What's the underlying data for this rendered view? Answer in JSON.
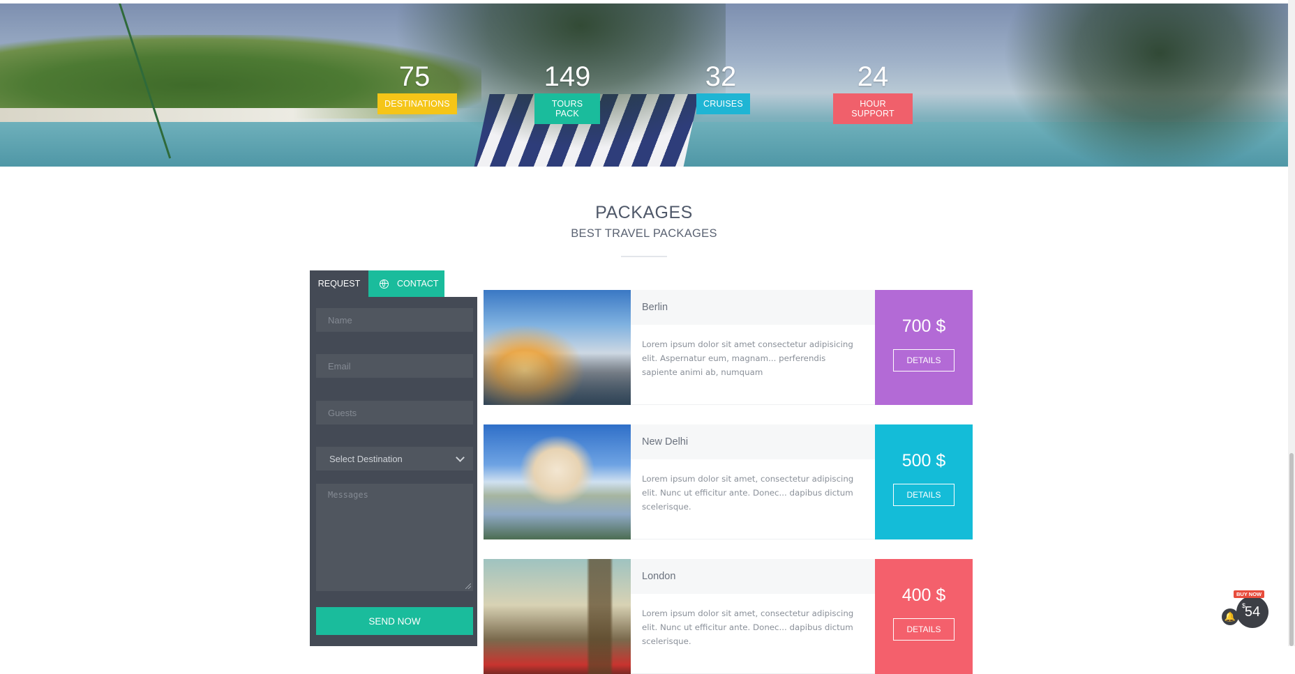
{
  "stats": [
    {
      "number": "75",
      "label": "DESTINATIONS",
      "color": "#f5c518"
    },
    {
      "number": "149",
      "label": "TOURS PACK",
      "color": "#1abc9c"
    },
    {
      "number": "32",
      "label": "CRUISES",
      "color": "#1fb5d4"
    },
    {
      "number": "24",
      "label": "HOUR SUPPORT",
      "color": "#f0606b"
    }
  ],
  "section": {
    "title": "PACKAGES",
    "subtitle": "BEST TRAVEL PACKAGES"
  },
  "form": {
    "tab_request": "REQUEST",
    "tab_contact": "CONTACT",
    "name_placeholder": "Name",
    "email_placeholder": "Email",
    "guests_placeholder": "Guests",
    "destination_selected": "Select Destination",
    "messages_placeholder": "Messages",
    "send_label": "SEND NOW"
  },
  "packages": [
    {
      "city": "Berlin",
      "description": "Lorem ipsum dolor sit amet consectetur adipisicing elit. Aspernatur eum, magnam... perferendis sapiente animi ab, numquam",
      "price": "700 $",
      "details_label": "DETAILS",
      "color": "#b36ad6"
    },
    {
      "city": "New Delhi",
      "description": "Lorem ipsum dolor sit amet, consectetur adipiscing elit. Nunc ut efficitur ante. Donec... dapibus dictum scelerisque.",
      "price": "500 $",
      "details_label": "DETAILS",
      "color": "#14bcd8"
    },
    {
      "city": "London",
      "description": "Lorem ipsum dolor sit amet, consectetur adipiscing elit. Nunc ut efficitur ante. Donec... dapibus dictum scelerisque.",
      "price": "400 $",
      "details_label": "DETAILS",
      "color": "#f4606c"
    }
  ],
  "badge": {
    "buy_now": "BUY NOW",
    "currency": "$",
    "count": "54",
    "bell_icon": "bell-icon"
  }
}
